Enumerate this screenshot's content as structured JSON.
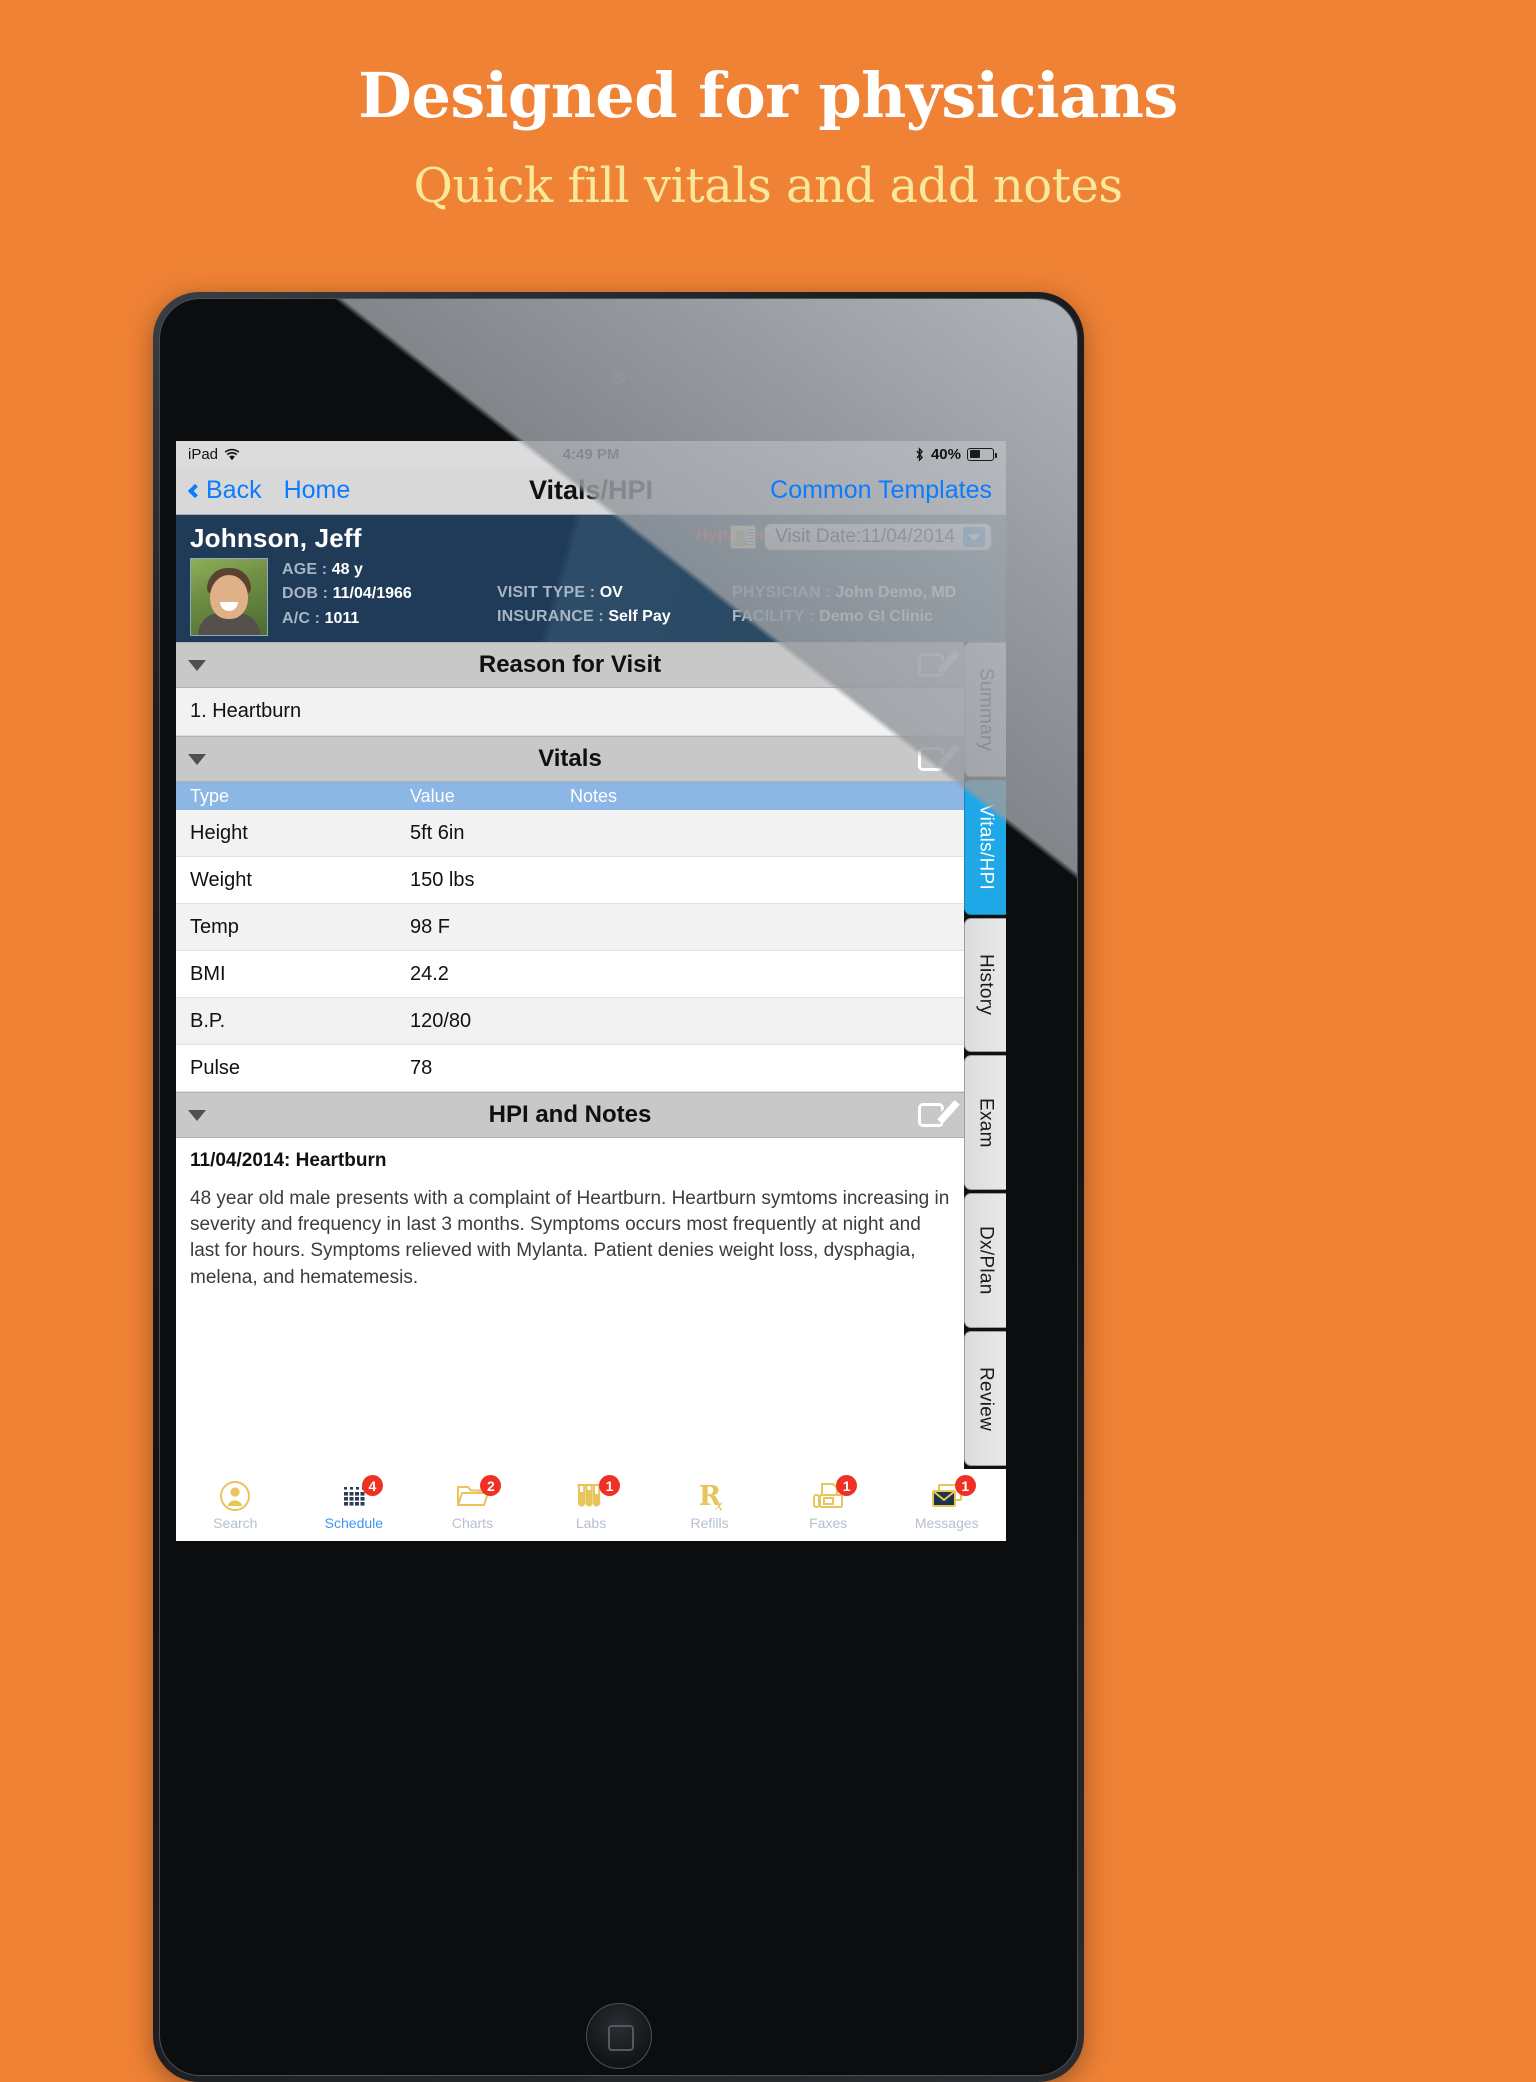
{
  "promo": {
    "title": "Designed for physicians",
    "subtitle": "Quick fill vitals and add notes"
  },
  "colors": {
    "background": "#ef8235",
    "title": "#ffffff",
    "subtitle": "#fae89a",
    "accent_blue": "#0b7bff",
    "tab_active": "#1ea8e8",
    "badge_red": "#ee3124",
    "alert_red": "#f23a2e",
    "header_navy": "#1f3b57"
  },
  "status_bar": {
    "carrier": "iPad",
    "wifi_icon": "wifi-icon",
    "time": "4:49 PM",
    "bluetooth_icon": "bluetooth-icon",
    "battery_percent": "40%",
    "battery_level": 40
  },
  "nav_bar": {
    "back_label": "Back",
    "home_label": "Home",
    "title": "Vitals/HPI",
    "right_action": "Common Templates"
  },
  "patient": {
    "name": "Johnson, Jeff",
    "alert": "Hypertension",
    "photo_alt": "patient-photo",
    "fields_left": [
      {
        "label": "AGE",
        "sep": ":",
        "value": "48 y"
      },
      {
        "label": "DOB",
        "sep": ":",
        "value": "11/04/1966"
      },
      {
        "label": "A/C",
        "sep": ":",
        "value": "1011"
      }
    ],
    "fields_mid": [
      {
        "label": "VISIT TYPE",
        "sep": ":",
        "value": "OV"
      },
      {
        "label": "INSURANCE",
        "sep": ":",
        "value": "Self Pay"
      }
    ],
    "fields_right": [
      {
        "label": "PHYSICIAN",
        "sep": ":",
        "value": "John Demo, MD"
      },
      {
        "label": "FACILITY",
        "sep": ":",
        "value": "Demo GI Clinic"
      }
    ],
    "visit_date_label": "Visit Date:11/04/2014"
  },
  "sections": {
    "reason": {
      "title": "Reason for Visit",
      "items": [
        "1. Heartburn"
      ]
    },
    "vitals": {
      "title": "Vitals",
      "columns": [
        "Type",
        "Value",
        "Notes"
      ],
      "rows": [
        {
          "type": "Height",
          "value": "5ft 6in",
          "notes": ""
        },
        {
          "type": "Weight",
          "value": "150 lbs",
          "notes": ""
        },
        {
          "type": "Temp",
          "value": "98 F",
          "notes": ""
        },
        {
          "type": "BMI",
          "value": "24.2",
          "notes": ""
        },
        {
          "type": "B.P.",
          "value": "120/80",
          "notes": ""
        },
        {
          "type": "Pulse",
          "value": "78",
          "notes": ""
        }
      ]
    },
    "hpi": {
      "title": "HPI and Notes",
      "entry_title": "11/04/2014: Heartburn",
      "entry_text": "48 year old male presents with a complaint of Heartburn.  Heartburn symtoms increasing in severity and frequency in last 3 months.  Symptoms occurs most frequently at night and last for hours.  Symptoms relieved with Mylanta.  Patient denies weight loss, dysphagia, melena, and hematemesis."
    }
  },
  "side_tabs": [
    {
      "label": "Summary",
      "active": false
    },
    {
      "label": "Vitals/HPI",
      "active": true
    },
    {
      "label": "History",
      "active": false
    },
    {
      "label": "Exam",
      "active": false
    },
    {
      "label": "Dx/Plan",
      "active": false
    },
    {
      "label": "Review",
      "active": false
    }
  ],
  "tab_bar": [
    {
      "label": "Search",
      "icon": "person-circle-icon",
      "badge": "",
      "active": false
    },
    {
      "label": "Schedule",
      "icon": "calendar-icon",
      "badge": "4",
      "active": true
    },
    {
      "label": "Charts",
      "icon": "folder-icon",
      "badge": "2",
      "active": false
    },
    {
      "label": "Labs",
      "icon": "test-tubes-icon",
      "badge": "1",
      "active": false
    },
    {
      "label": "Refills",
      "icon": "rx-icon",
      "badge": "",
      "active": false
    },
    {
      "label": "Faxes",
      "icon": "fax-icon",
      "badge": "1",
      "active": false
    },
    {
      "label": "Messages",
      "icon": "envelope-icon",
      "badge": "1",
      "active": false
    }
  ]
}
